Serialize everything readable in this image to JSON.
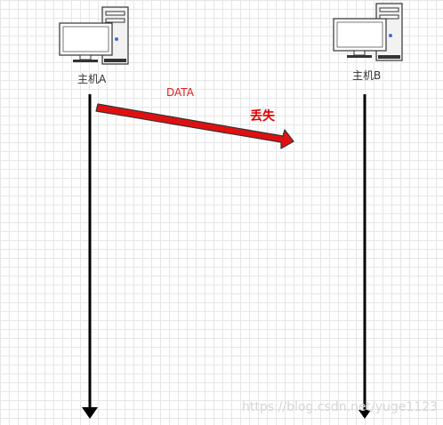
{
  "hosts": {
    "a_label": "主机A",
    "b_label": "主机B"
  },
  "message": {
    "label": "DATA",
    "status": "丢失",
    "arrow_color": "#e01010"
  },
  "watermark": "https://blog.csdn.net/yuge1123",
  "colors": {
    "lifeline": "#000000",
    "grid": "#e6e6e6",
    "lost_text": "#e00000"
  }
}
